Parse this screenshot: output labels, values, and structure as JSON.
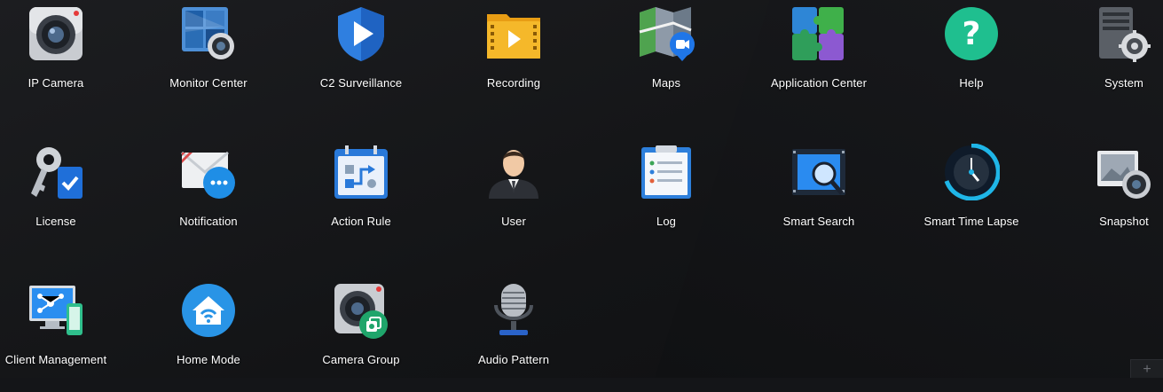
{
  "apps": [
    {
      "label": "IP Camera",
      "icon": "ip-camera-icon"
    },
    {
      "label": "Monitor Center",
      "icon": "monitor-center-icon"
    },
    {
      "label": "C2 Surveillance",
      "icon": "c2-surveillance-icon"
    },
    {
      "label": "Recording",
      "icon": "recording-icon"
    },
    {
      "label": "Maps",
      "icon": "maps-icon"
    },
    {
      "label": "Application Center",
      "icon": "application-center-icon"
    },
    {
      "label": "Help",
      "icon": "help-icon"
    },
    {
      "label": "System",
      "icon": "system-icon"
    },
    {
      "label": "License",
      "icon": "license-icon"
    },
    {
      "label": "Notification",
      "icon": "notification-icon"
    },
    {
      "label": "Action Rule",
      "icon": "action-rule-icon"
    },
    {
      "label": "User",
      "icon": "user-icon"
    },
    {
      "label": "Log",
      "icon": "log-icon"
    },
    {
      "label": "Smart Search",
      "icon": "smart-search-icon"
    },
    {
      "label": "Smart Time Lapse",
      "icon": "smart-time-lapse-icon"
    },
    {
      "label": "Snapshot",
      "icon": "snapshot-icon"
    },
    {
      "label": "Client Management",
      "icon": "client-management-icon"
    },
    {
      "label": "Home Mode",
      "icon": "home-mode-icon"
    },
    {
      "label": "Camera Group",
      "icon": "camera-group-icon"
    },
    {
      "label": "Audio Pattern",
      "icon": "audio-pattern-icon"
    }
  ],
  "corner_button": {
    "label": "+",
    "icon": "plus-icon"
  },
  "colors": {
    "background": "#141518",
    "label": "#ffffff"
  }
}
